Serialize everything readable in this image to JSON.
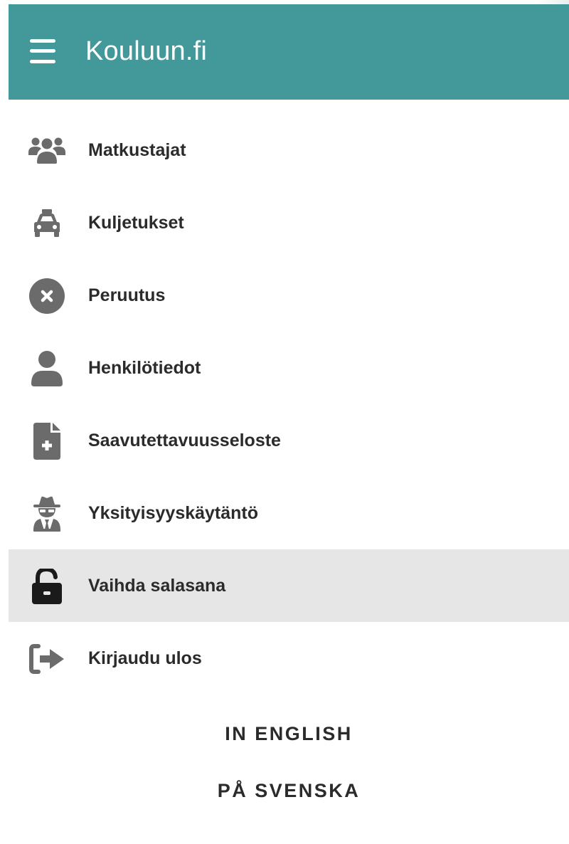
{
  "header": {
    "menu_icon": "hamburger-icon",
    "title": "Kouluun.fi",
    "background_color": "#43989a"
  },
  "menu": {
    "items": [
      {
        "label": "Matkustajat",
        "icon": "users-icon",
        "active": false
      },
      {
        "label": "Kuljetukset",
        "icon": "taxi-icon",
        "active": false
      },
      {
        "label": "Peruutus",
        "icon": "cancel-circle-icon",
        "active": false
      },
      {
        "label": "Henkilötiedot",
        "icon": "user-icon",
        "active": false
      },
      {
        "label": "Saavutettavuusseloste",
        "icon": "file-medical-icon",
        "active": false
      },
      {
        "label": "Yksityisyyskäytäntö",
        "icon": "user-secret-icon",
        "active": false
      },
      {
        "label": "Vaihda salasana",
        "icon": "unlock-icon",
        "active": true
      },
      {
        "label": "Kirjaudu ulos",
        "icon": "sign-out-icon",
        "active": false
      }
    ],
    "active_background": "#e6e6e6",
    "icon_color": "#6b6b6b",
    "active_icon_color": "#1a1a1a"
  },
  "language_links": {
    "english": "IN ENGLISH",
    "swedish": "PÅ SVENSKA"
  }
}
